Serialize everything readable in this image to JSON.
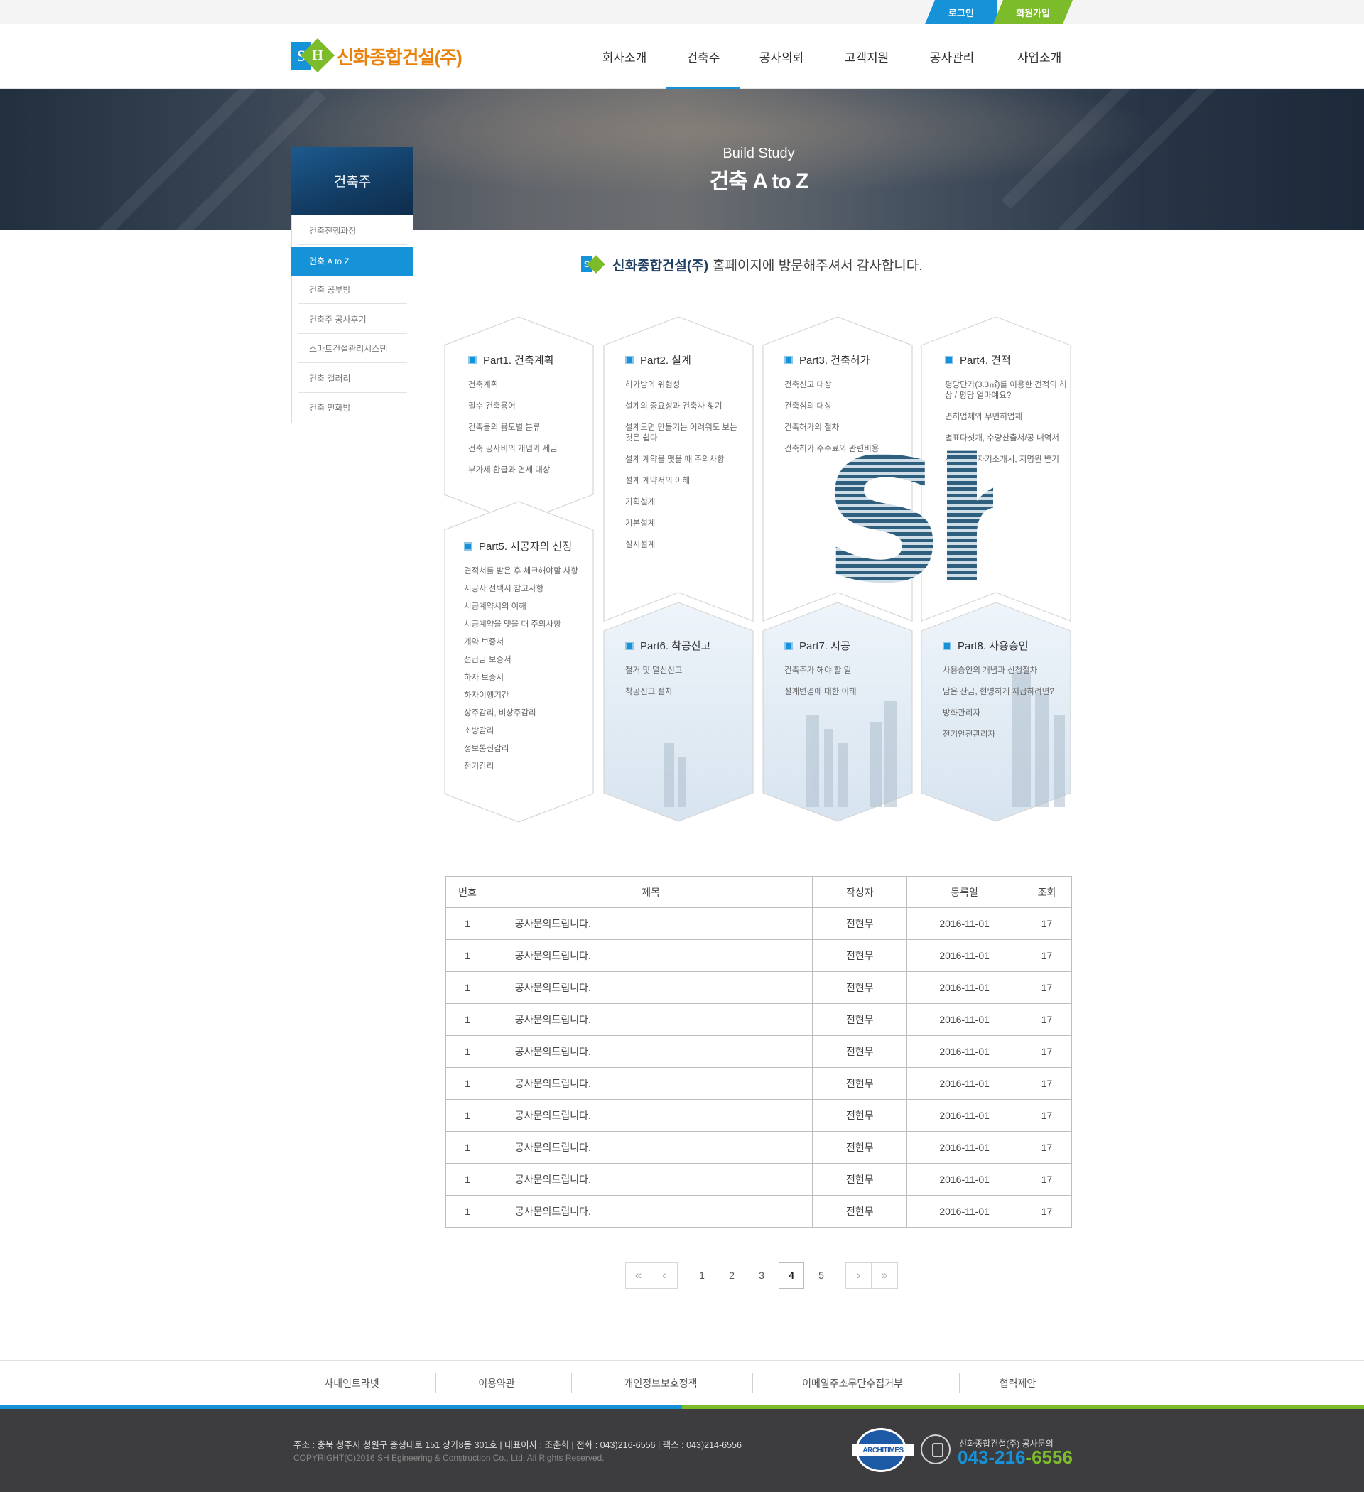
{
  "util": {
    "login": "로그인",
    "join": "회원가입"
  },
  "brand": {
    "s": "S",
    "h": "H",
    "name": "신화종합건설(주)"
  },
  "gnb": [
    "회사소개",
    "건축주",
    "공사의뢰",
    "고객지원",
    "공사관리",
    "사업소개"
  ],
  "gnb_active_index": 1,
  "hero": {
    "subtitle": "Build Study",
    "title": "건축 A to Z"
  },
  "side": {
    "title": "건축주",
    "items": [
      "건축진행과정",
      "건축 A to Z",
      "건축 공부방",
      "건축주 공사후기",
      "스마트건설관리시스템",
      "건축 갤러리",
      "건축 민화방"
    ],
    "active_index": 1
  },
  "welcome": {
    "brand": "신화종합건설(주)",
    "message": "홈페이지에 방문해주셔서 감사합니다."
  },
  "parts": [
    {
      "title": "Part1. 건축계획",
      "items": [
        "건축계획",
        "필수 건축용어",
        "건축물의 용도별 분류",
        "건축 공사비의 개념과 세금",
        "부가세 환급과 면세 대상"
      ]
    },
    {
      "title": "Part2. 설계",
      "items": [
        "허가방의 위험성",
        "설계의 중요성과 건축사 찾기",
        "설계도면 만들기는 어려워도 보는 것은 쉽다",
        "설계 계약을 맺을 때 주의사항",
        "설계 계약서의 이해",
        "기획설계",
        "기본설계",
        "실시설계"
      ]
    },
    {
      "title": "Part3. 건축허가",
      "items": [
        "건축신고 대상",
        "건축심의 대상",
        "건축허가의 절차",
        "건축허가 수수료와 관련비용"
      ]
    },
    {
      "title": "Part4. 견적",
      "items": [
        "평당단가(3.3㎡)를 이용한 견적의 허상 / 평당 얼마예요?",
        "면허업체와 무면허업체",
        "별표다섯개, 수량산출서/공 내역서",
        "시공사의 자기소개서, 지명원 받기"
      ]
    },
    {
      "title": "Part5. 시공자의 선정",
      "items": [
        "견적서를 받은 후 체크해야할 사항",
        "시공사 선택시 참고사항",
        "시공계약서의 이해",
        "시공계약을 맺을 때 주의사항",
        "계약 보증서",
        "선급금 보증서",
        "하자 보증서",
        "하자이행기간",
        "상주감리, 비상주감리",
        "소방감리",
        "정보통신감리",
        "전기감리"
      ]
    },
    {
      "title": "Part6. 착공신고",
      "items": [
        "철거 및 멸신신고",
        "착공신고 절차"
      ]
    },
    {
      "title": "Part7. 시공",
      "items": [
        "건축주가 해야 할 일",
        "설계변경에 대한 이해"
      ]
    },
    {
      "title": "Part8. 사용승인",
      "items": [
        "사용승인의 개념과 신청절차",
        "남은 잔금, 현명하게 지급하려면?",
        "방화관리자",
        "전기안전관리자"
      ]
    }
  ],
  "watermark": "Sh",
  "board": {
    "headers": [
      "번호",
      "제목",
      "작성자",
      "등록일",
      "조회"
    ],
    "rows": [
      [
        "1",
        "공사문의드립니다.",
        "전현무",
        "2016-11-01",
        "17"
      ],
      [
        "1",
        "공사문의드립니다.",
        "전현무",
        "2016-11-01",
        "17"
      ],
      [
        "1",
        "공사문의드립니다.",
        "전현무",
        "2016-11-01",
        "17"
      ],
      [
        "1",
        "공사문의드립니다.",
        "전현무",
        "2016-11-01",
        "17"
      ],
      [
        "1",
        "공사문의드립니다.",
        "전현무",
        "2016-11-01",
        "17"
      ],
      [
        "1",
        "공사문의드립니다.",
        "전현무",
        "2016-11-01",
        "17"
      ],
      [
        "1",
        "공사문의드립니다.",
        "전현무",
        "2016-11-01",
        "17"
      ],
      [
        "1",
        "공사문의드립니다.",
        "전현무",
        "2016-11-01",
        "17"
      ],
      [
        "1",
        "공사문의드립니다.",
        "전현무",
        "2016-11-01",
        "17"
      ],
      [
        "1",
        "공사문의드립니다.",
        "전현무",
        "2016-11-01",
        "17"
      ]
    ]
  },
  "pager": {
    "first_icon": "double-chevron-left-icon",
    "prev_icon": "chevron-left-icon",
    "next_icon": "chevron-right-icon",
    "last_icon": "double-chevron-right-icon",
    "pages": [
      "1",
      "2",
      "3",
      "4",
      "5"
    ],
    "current": "4"
  },
  "footer_links": [
    "사내인트라넷",
    "이용약관",
    "개인정보보호정책",
    "이메일주소무단수집거부",
    "협력제안"
  ],
  "footer": {
    "address": "주소 : 충북 청주시 청원구 충청대로 151 상가8동 301호  |  대표이사 : 조춘희  |  전화 : 043)216-6556  |  팩스 : 043)214-6556",
    "copyright": "COPYRIGHT(C)2016  SH Egineering & Construction  Co., Ltd. All Rights Reserved.",
    "badge": "ARCHITIMES",
    "cs_label": "신화종합건설(주) 공사문의",
    "phone_a": "043-216",
    "phone_b": "-6556"
  },
  "colors": {
    "blue": "#1693d8",
    "green": "#7cbb2a",
    "orange": "#e8820c",
    "navy": "#133e66",
    "footer_bg": "#3d3d3f"
  }
}
